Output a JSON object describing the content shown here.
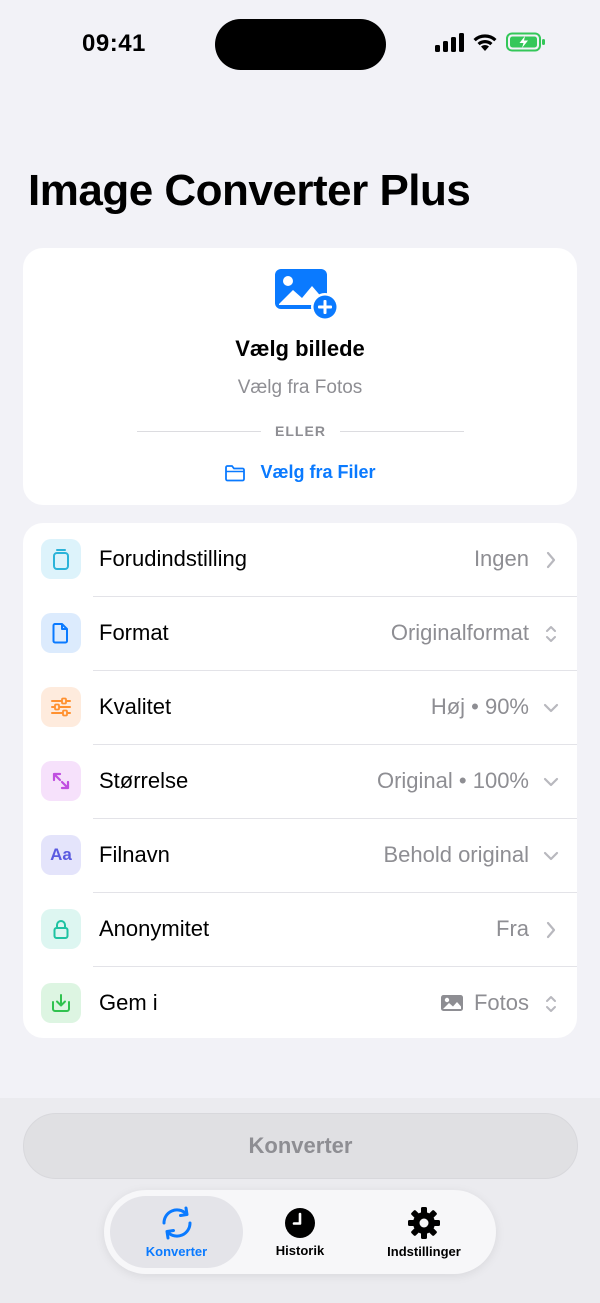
{
  "status_bar": {
    "time": "09:41"
  },
  "title": "Image Converter Plus",
  "picker": {
    "title": "Vælg billede",
    "subtitle": "Vælg fra Fotos",
    "divider": "ELLER",
    "files_link": "Vælg fra Filer"
  },
  "settings": [
    {
      "label": "Forudindstilling",
      "value": "Ingen",
      "icon": "jar-icon",
      "chevron": "chevron-right"
    },
    {
      "label": "Format",
      "value": "Originalformat",
      "icon": "document-icon",
      "chevron": "chevron-updown"
    },
    {
      "label": "Kvalitet",
      "value": "Høj • 90%",
      "icon": "sliders-icon",
      "chevron": "chevron-down"
    },
    {
      "label": "Størrelse",
      "value": "Original • 100%",
      "icon": "resize-arrows-icon",
      "chevron": "chevron-down"
    },
    {
      "label": "Filnavn",
      "value": "Behold original",
      "icon": "text-aa-icon",
      "chevron": "chevron-down"
    },
    {
      "label": "Anonymitet",
      "value": "Fra",
      "icon": "lock-icon",
      "chevron": "chevron-right"
    },
    {
      "label": "Gem i",
      "value": "Fotos",
      "icon": "save-down-icon",
      "chevron": "chevron-updown"
    }
  ],
  "convert_button": "Konverter",
  "tabs": [
    {
      "label": "Konverter",
      "icon": "convert-arrows-icon",
      "active": true
    },
    {
      "label": "Historik",
      "icon": "clock-icon",
      "active": false
    },
    {
      "label": "Indstillinger",
      "icon": "gear-icon",
      "active": false
    }
  ],
  "colors": {
    "accent": "#0A7AFF",
    "background": "#F2F2F7",
    "battery": "#34C759"
  }
}
